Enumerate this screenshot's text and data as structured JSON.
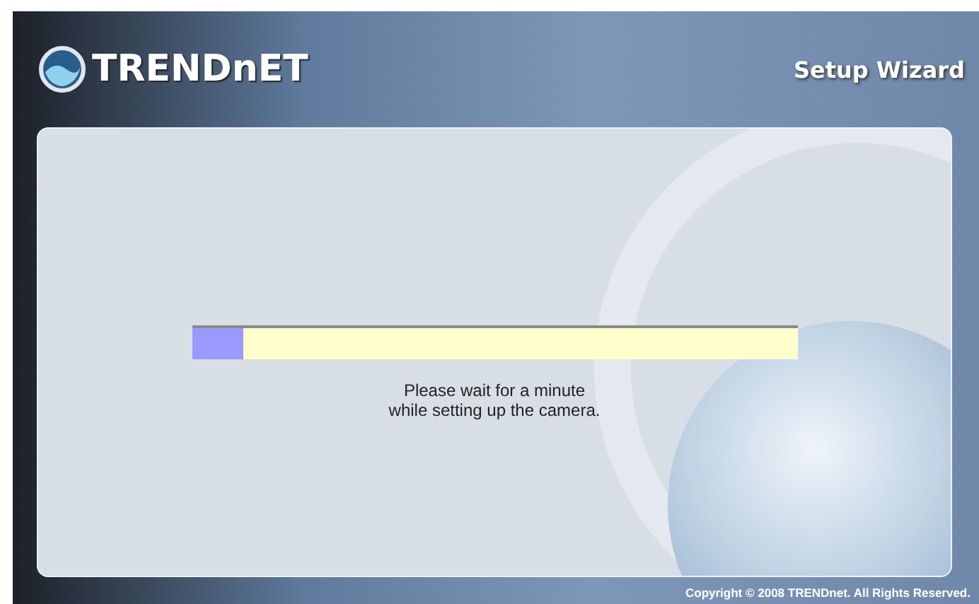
{
  "header": {
    "logo": "TRENDnET",
    "title": "Setup Wizard"
  },
  "progress": {
    "level": 0.086
  },
  "message": [
    "Please wait for a minute",
    "while setting up the camera."
  ],
  "footer": {
    "copyright": "Copyright © 2008 TRENDnet. All Rights Reserved."
  }
}
